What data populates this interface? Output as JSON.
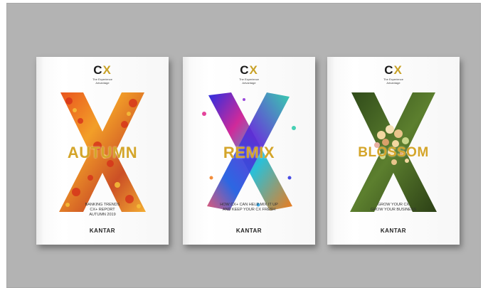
{
  "books": [
    {
      "logo_text": "CX",
      "tagline": "The Experience\nAdvantage",
      "title": "AUTUMN",
      "subtitle_lines": [
        "BANKING TRENDS",
        "CX+ REPORT",
        "AUTUMN 2019"
      ],
      "brand": "KANTAR",
      "accent": "#e0761c"
    },
    {
      "logo_text": "CX",
      "tagline": "The Experience\nAdvantage",
      "title": "REMIX",
      "subtitle_lines": [
        "HOW CX+ CAN HELP MIX IT UP",
        "AND KEEP YOUR CX FRESH"
      ],
      "brand": "KANTAR",
      "accent": "#3a3ad0"
    },
    {
      "logo_text": "CX",
      "tagline": "The Experience\nAdvantage",
      "title": "BLOSSOM",
      "subtitle_lines": [
        "GROW YOUR CX",
        "GROW YOUR BUSINESS"
      ],
      "brand": "KANTAR",
      "accent": "#4a6b2a"
    }
  ],
  "colors": {
    "background": "#b3b3b3",
    "title_gold": "#d4a52a",
    "logo_x_gold": "#c9a227"
  }
}
